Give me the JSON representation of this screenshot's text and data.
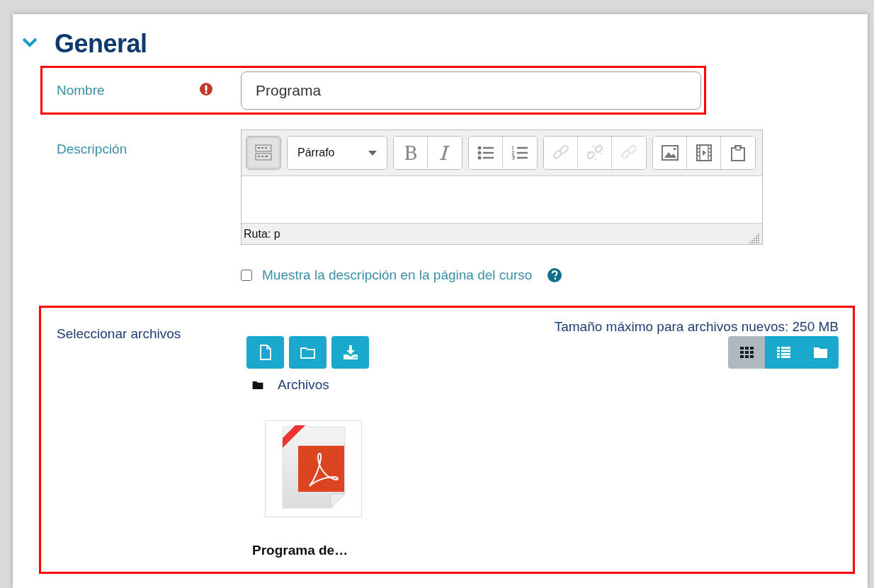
{
  "section": {
    "title": "General",
    "expanded": true
  },
  "name_field": {
    "label": "Nombre",
    "required": true,
    "value": "Programa",
    "highlighted": true
  },
  "description": {
    "label": "Descripción",
    "toolbar": [
      [
        {
          "kind": "toggle",
          "disabled": false,
          "selected": true
        }
      ],
      [
        {
          "kind": "select",
          "value": "Párrafo"
        }
      ],
      [
        {
          "kind": "bold",
          "disabled": false,
          "selected": false
        },
        {
          "kind": "italic",
          "disabled": false,
          "selected": false
        }
      ],
      [
        {
          "kind": "bullets",
          "disabled": false,
          "selected": false
        },
        {
          "kind": "numbers",
          "disabled": false,
          "selected": false
        }
      ],
      [
        {
          "kind": "link",
          "disabled": true,
          "selected": false
        },
        {
          "kind": "unlink",
          "disabled": true,
          "selected": false
        },
        {
          "kind": "anchor",
          "disabled": true,
          "selected": false
        }
      ],
      [
        {
          "kind": "image",
          "disabled": false,
          "selected": false
        },
        {
          "kind": "media",
          "disabled": false,
          "selected": false
        },
        {
          "kind": "paste",
          "disabled": false,
          "selected": false
        }
      ]
    ],
    "path": "Ruta: p"
  },
  "show_description": {
    "label": "Muestra la descripción en la página del curso",
    "checked": false
  },
  "files": {
    "label": "Seleccionar archivos",
    "max_size": "Tamaño máximo para archivos nuevos: 250 MB",
    "highlighted": true,
    "actions": [
      {
        "kind": "add-file"
      },
      {
        "kind": "new-folder"
      },
      {
        "kind": "download"
      }
    ],
    "views": [
      {
        "kind": "icons",
        "selected": true
      },
      {
        "kind": "list",
        "selected": false
      },
      {
        "kind": "tree",
        "selected": false
      }
    ],
    "path": "Archivos",
    "items": [
      {
        "kind": "pdf",
        "name": "Programa de…"
      }
    ]
  }
}
